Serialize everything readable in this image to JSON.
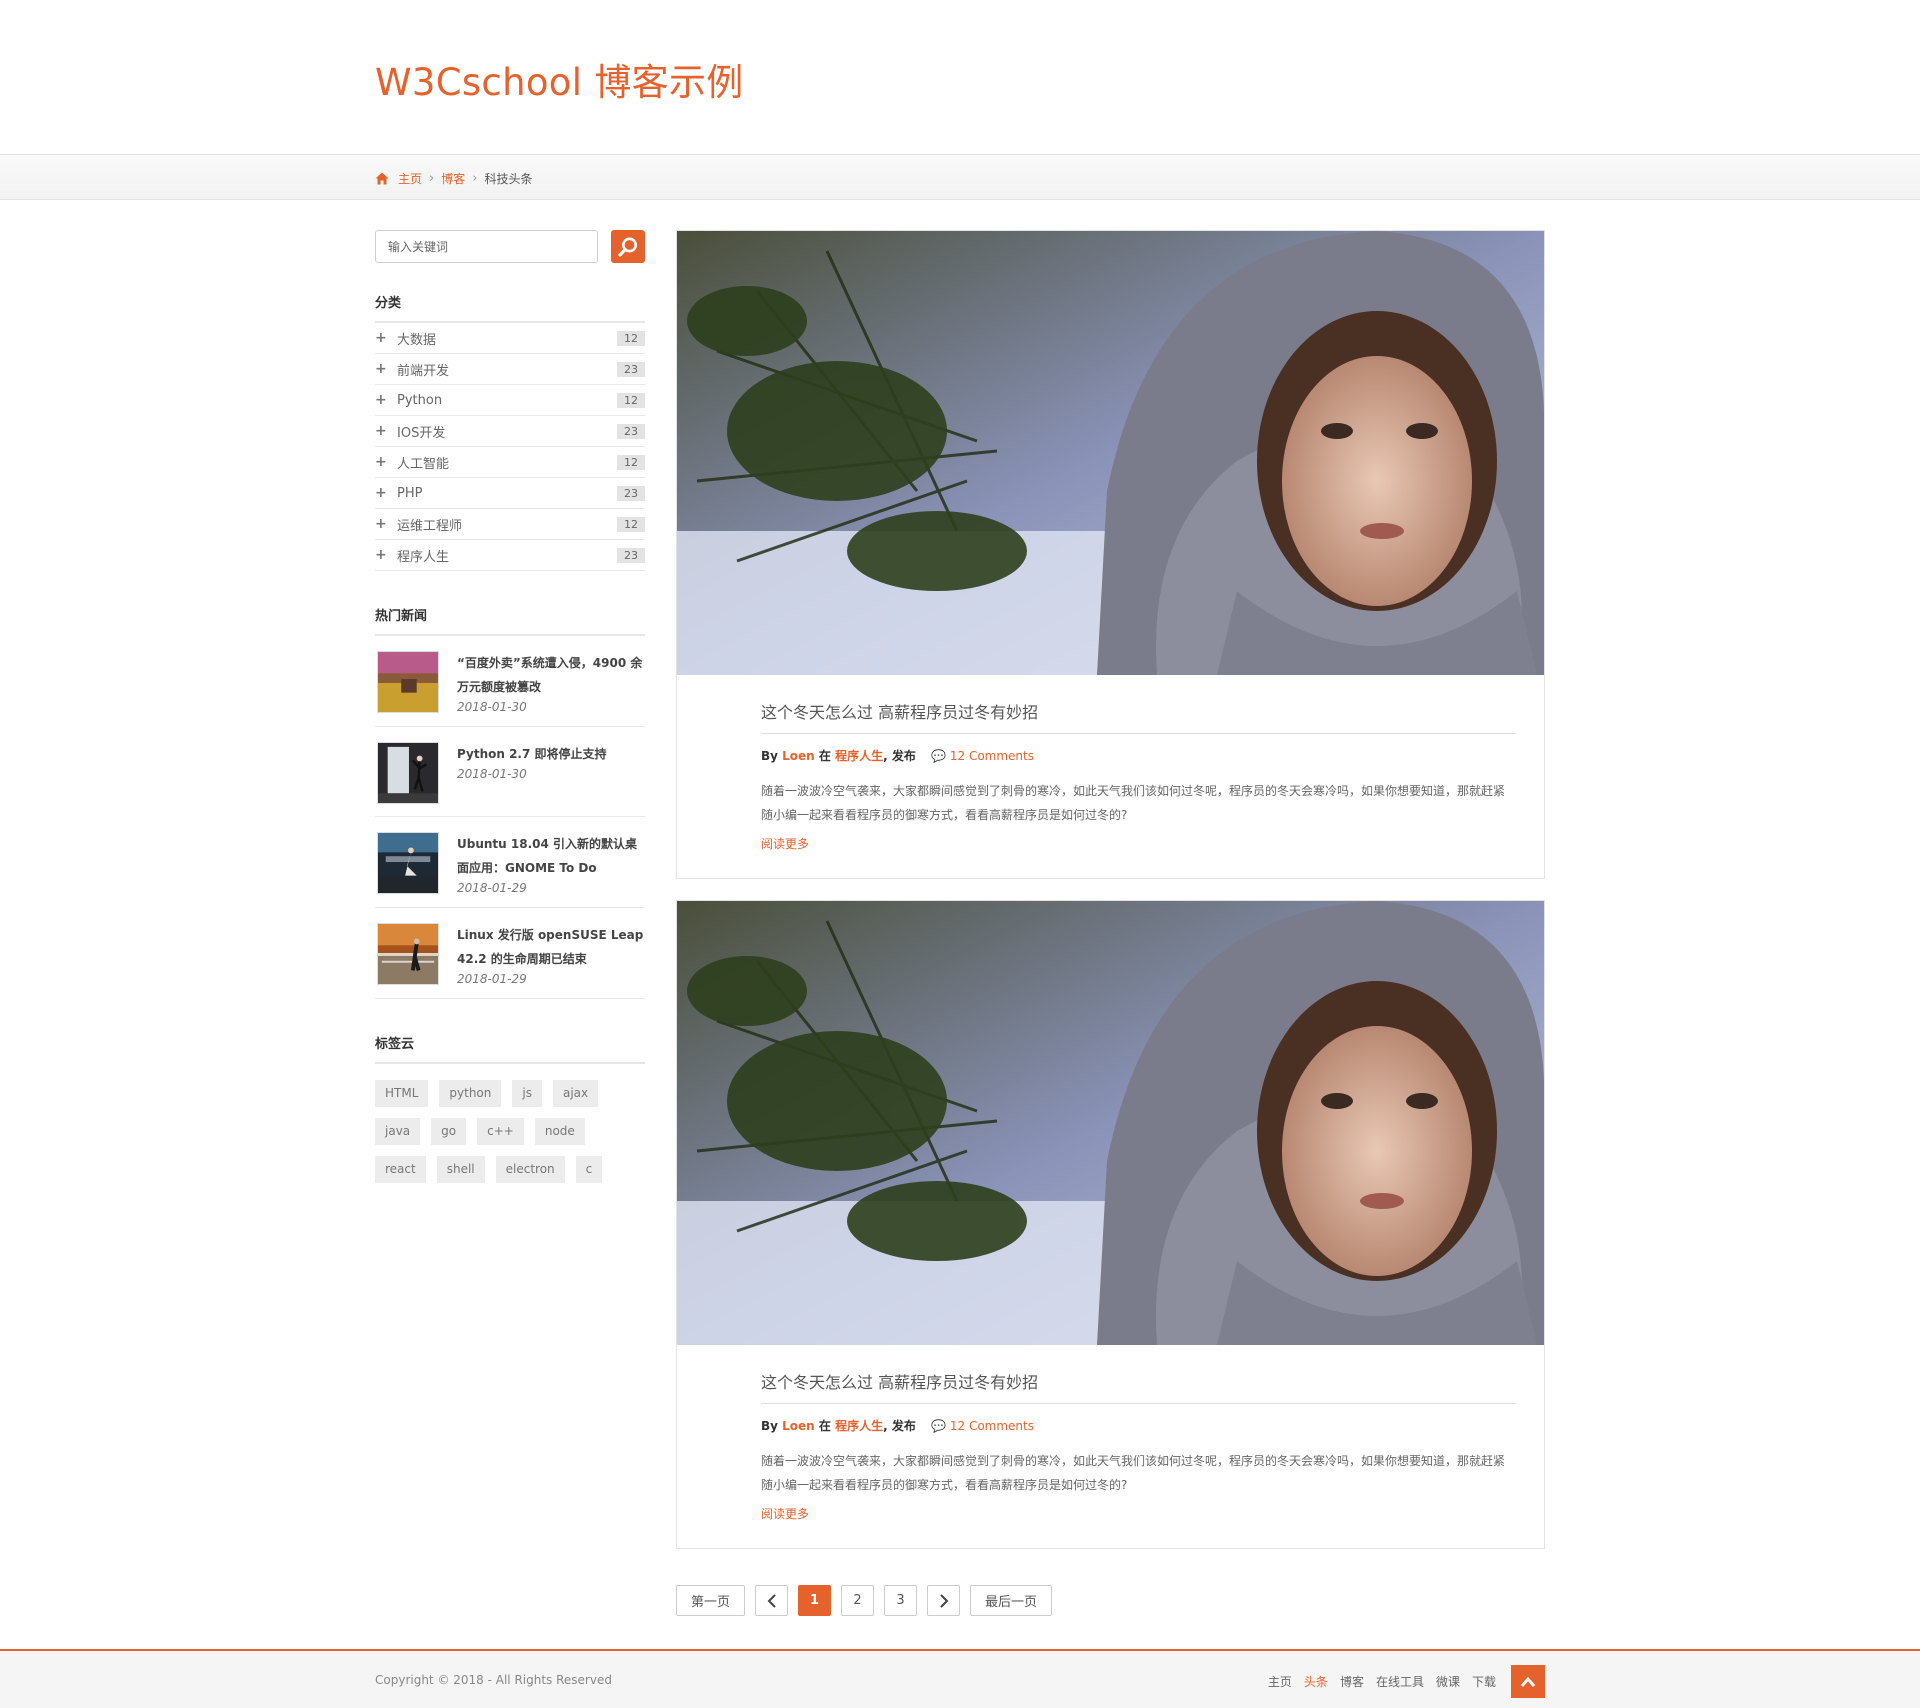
{
  "site": {
    "title": "W3Cschool 博客示例"
  },
  "breadcrumb": {
    "home": "主页",
    "blog": "博客",
    "current": "科技头条"
  },
  "search": {
    "placeholder": "输入关键词"
  },
  "categories": {
    "title": "分类",
    "items": [
      {
        "label": "大数据",
        "count": "12"
      },
      {
        "label": "前端开发",
        "count": "23"
      },
      {
        "label": "Python",
        "count": "12"
      },
      {
        "label": "IOS开发",
        "count": "23"
      },
      {
        "label": "人工智能",
        "count": "12"
      },
      {
        "label": "PHP",
        "count": "23"
      },
      {
        "label": "运维工程师",
        "count": "12"
      },
      {
        "label": "程序人生",
        "count": "23"
      }
    ]
  },
  "hot_news": {
    "title": "热门新闻",
    "items": [
      {
        "headline": "“百度外卖”系统遭入侵，4900 余万元额度被篡改",
        "date": "2018-01-30"
      },
      {
        "headline": "Python 2.7 即将停止支持",
        "date": "2018-01-30"
      },
      {
        "headline": "Ubuntu 18.04 引入新的默认桌面应用：GNOME To Do",
        "date": "2018-01-29"
      },
      {
        "headline": "Linux 发行版 openSUSE Leap 42.2 的生命周期已结束",
        "date": "2018-01-29"
      }
    ]
  },
  "tag_cloud": {
    "title": "标签云",
    "tags": [
      "HTML",
      "python",
      "js",
      "ajax",
      "java",
      "go",
      "c++",
      "node",
      "react",
      "shell",
      "electron",
      "c"
    ]
  },
  "posts": [
    {
      "title": "这个冬天怎么过 高薪程序员过冬有妙招",
      "by": "By",
      "author": "Loen",
      "in": "在",
      "category": "程序人生",
      "published": ", 发布",
      "comments": "12 Comments",
      "excerpt": "随着一波波冷空气袭来，大家都瞬间感觉到了刺骨的寒冷，如此天气我们该如何过冬呢，程序员的冬天会寒冷吗，如果你想要知道，那就赶紧随小编一起来看看程序员的御寒方式，看看高薪程序员是如何过冬的?",
      "read_more": "阅读更多"
    },
    {
      "title": "这个冬天怎么过 高薪程序员过冬有妙招",
      "by": "By",
      "author": "Loen",
      "in": "在",
      "category": "程序人生",
      "published": ", 发布",
      "comments": "12 Comments",
      "excerpt": "随着一波波冷空气袭来，大家都瞬间感觉到了刺骨的寒冷，如此天气我们该如何过冬呢，程序员的冬天会寒冷吗，如果你想要知道，那就赶紧随小编一起来看看程序员的御寒方式，看看高薪程序员是如何过冬的?",
      "read_more": "阅读更多"
    }
  ],
  "pagination": {
    "first": "第一页",
    "pages": [
      "1",
      "2",
      "3"
    ],
    "current": "1",
    "last": "最后一页"
  },
  "footer": {
    "copyright": "Copyright © 2018 - All Rights Reserved",
    "nav": [
      "主页",
      "头条",
      "博客",
      "在线工具",
      "微课",
      "下载"
    ],
    "active_nav": "头条"
  },
  "colors": {
    "accent": "#e6622d",
    "border": "#e2e2e2",
    "footer_bg": "#f5f5f5"
  },
  "icons": [
    "home-icon",
    "chevron-right-icon",
    "search-icon",
    "plus-icon",
    "comment-icon",
    "chevron-left-icon",
    "arrow-up-icon"
  ]
}
